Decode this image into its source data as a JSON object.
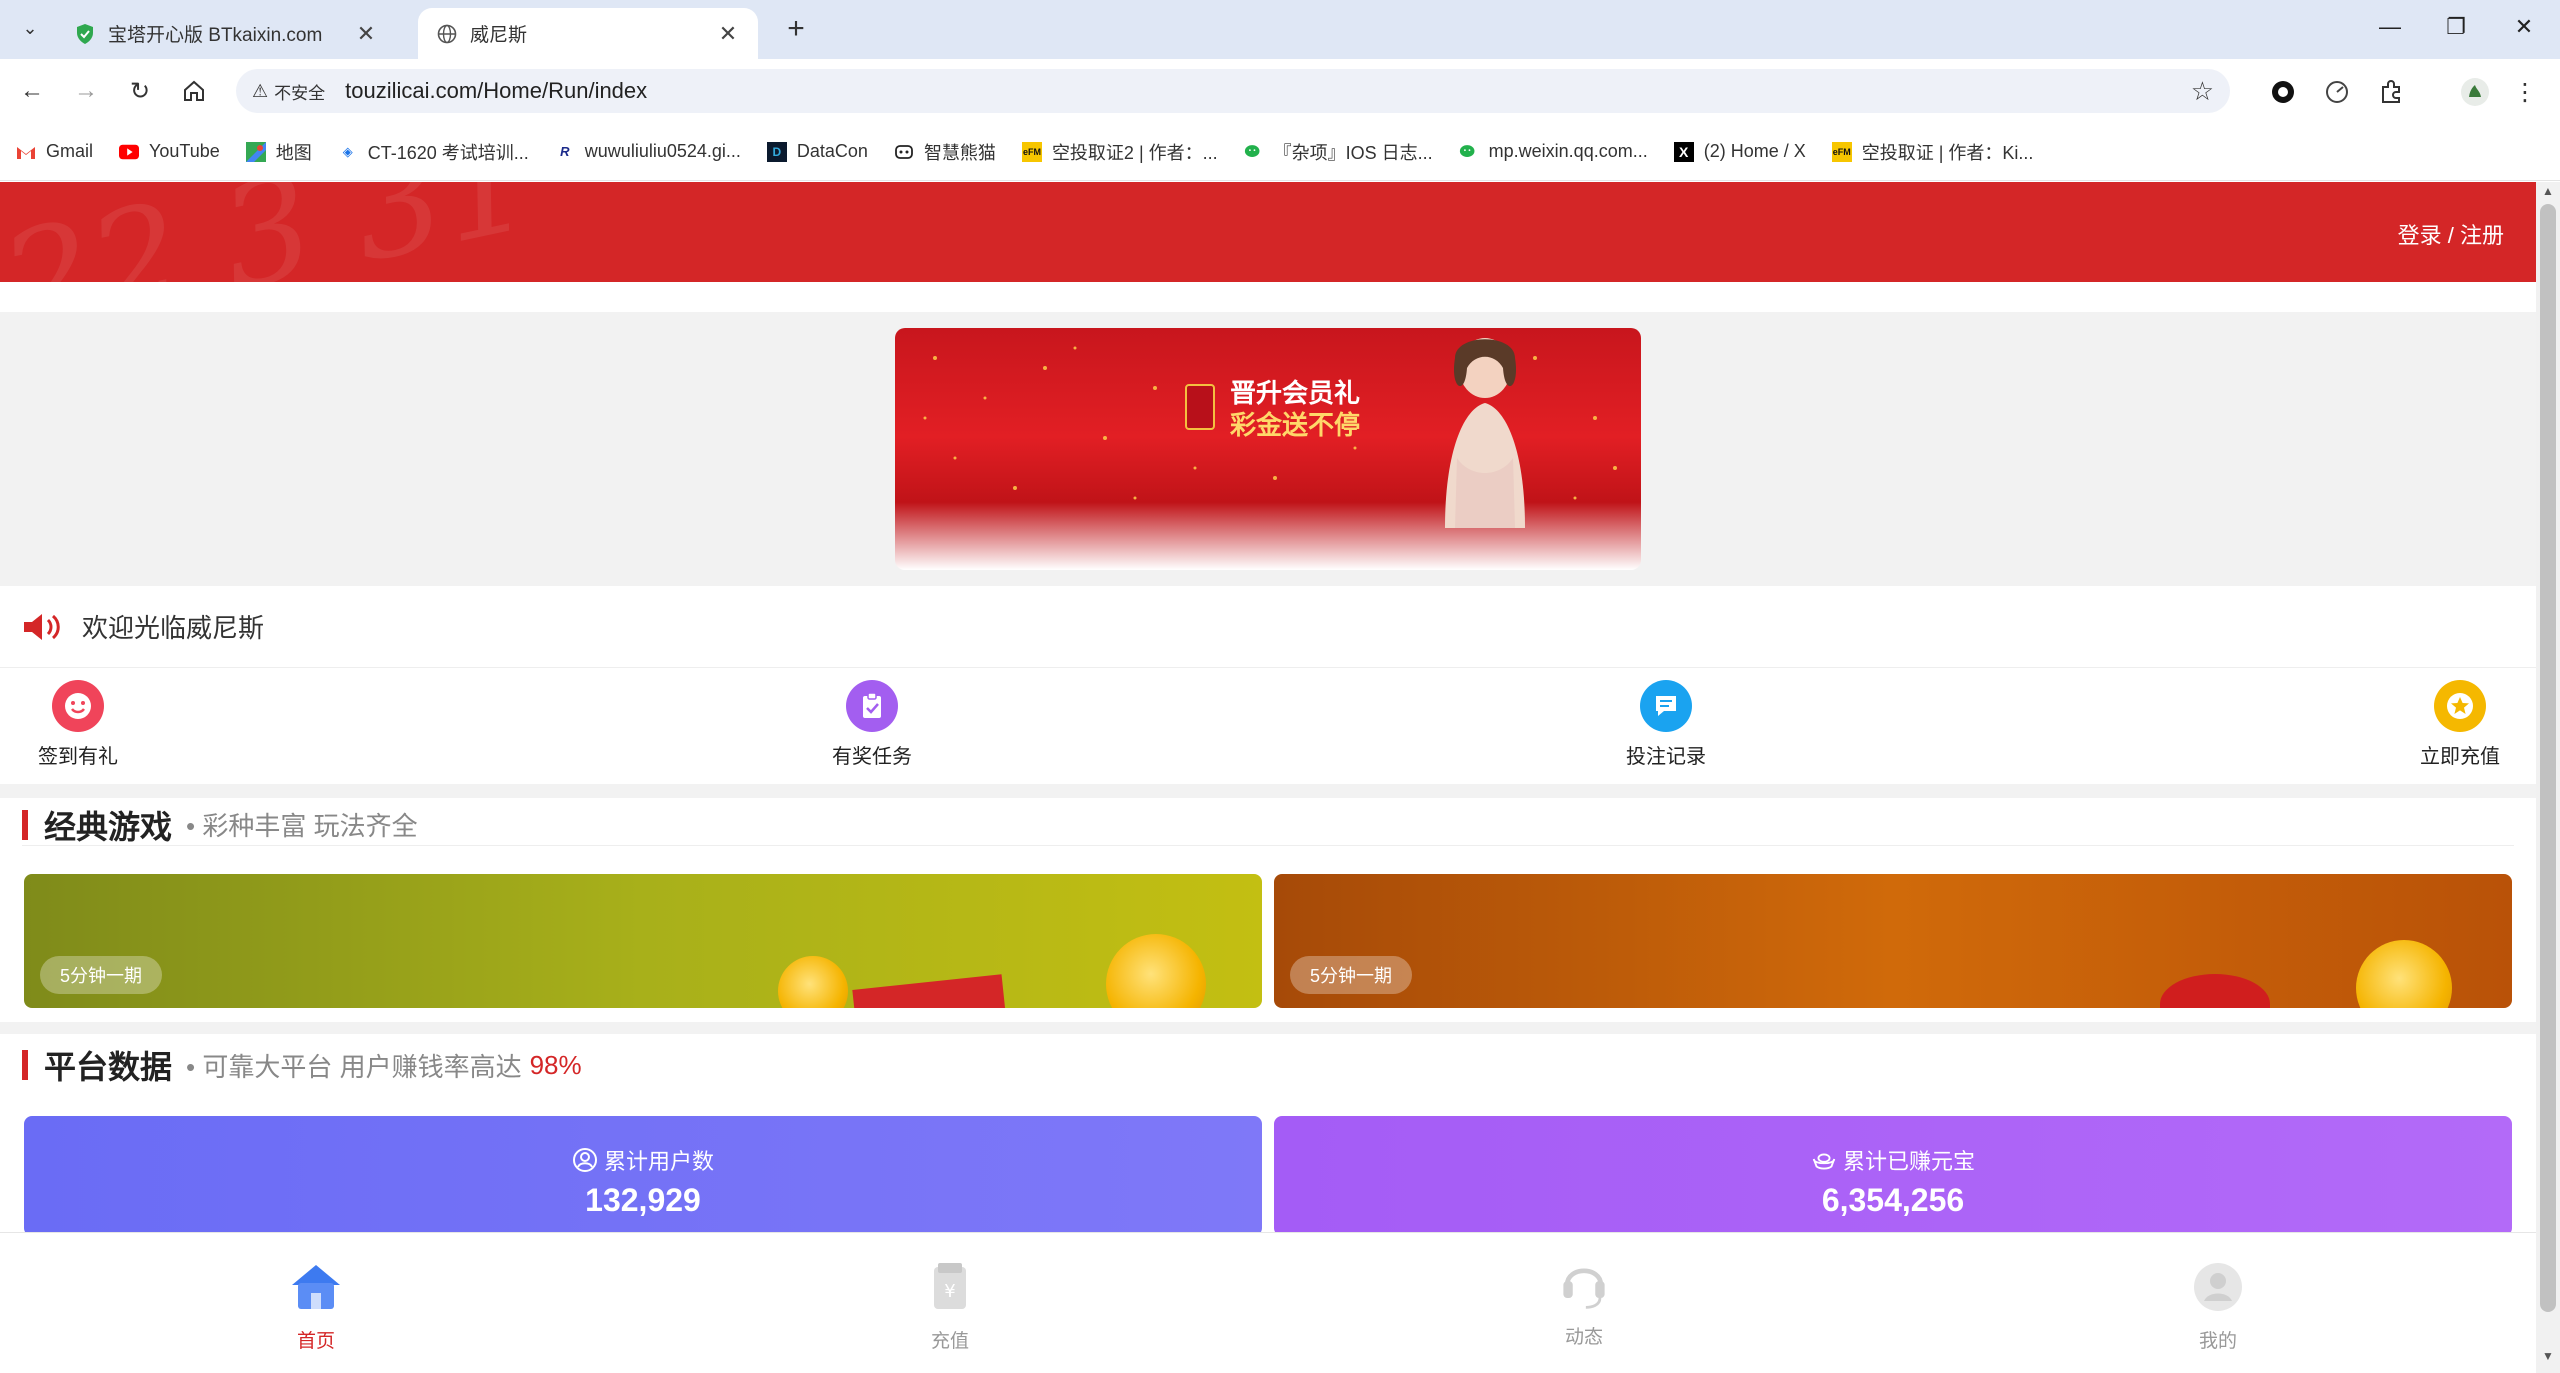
{
  "browser": {
    "tabs": [
      {
        "title": "宝塔开心版 BTkaixin.com",
        "active": false
      },
      {
        "title": "威尼斯",
        "active": true
      }
    ],
    "security_label": "不安全",
    "url": "touzilicai.com/Home/Run/index",
    "bookmarks": [
      {
        "label": "Gmail",
        "icon": "gmail-icon"
      },
      {
        "label": "YouTube",
        "icon": "youtube-icon"
      },
      {
        "label": "地图",
        "icon": "maps-icon"
      },
      {
        "label": "CT-1620 考试培训...",
        "icon": "diamond-icon"
      },
      {
        "label": "wuwuliuliu0524.gi...",
        "icon": "r-icon"
      },
      {
        "label": "DataCon",
        "icon": "datacon-icon"
      },
      {
        "label": "智慧熊猫",
        "icon": "panda-icon"
      },
      {
        "label": "空投取证2 | 作者：...",
        "icon": "efm-icon"
      },
      {
        "label": "『杂项』IOS 日志...",
        "icon": "wechat-icon"
      },
      {
        "label": "mp.weixin.qq.com...",
        "icon": "wechat-icon"
      },
      {
        "label": "(2) Home / X",
        "icon": "x-icon"
      },
      {
        "label": "空投取证 | 作者：Ki...",
        "icon": "efm-icon"
      }
    ]
  },
  "header": {
    "login_label": "登录 / 注册"
  },
  "banner": {
    "line1": "晋升会员礼",
    "line2": "彩金送不停"
  },
  "welcome": {
    "message": "欢迎光临威尼斯"
  },
  "quick_actions": [
    {
      "label": "签到有礼",
      "icon": "smile-icon",
      "color": "#f0445a"
    },
    {
      "label": "有奖任务",
      "icon": "clipboard-check-icon",
      "color": "#a35ef0"
    },
    {
      "label": "投注记录",
      "icon": "document-icon",
      "color": "#1aa3f0"
    },
    {
      "label": "立即充值",
      "icon": "star-coin-icon",
      "color": "#f5b800"
    }
  ],
  "classic_games": {
    "title": "经典游戏",
    "subtitle": "• 彩种丰富 玩法齐全",
    "cards": [
      {
        "tag": "5分钟一期"
      },
      {
        "tag": "5分钟一期"
      }
    ]
  },
  "platform_data": {
    "title": "平台数据",
    "subtitle": "• 可靠大平台 用户赚钱率高达",
    "highlight": "98%",
    "stats": [
      {
        "label": "累计用户数",
        "value": "132,929",
        "icon": "user-circle-icon"
      },
      {
        "label": "累计已赚元宝",
        "value": "6,354,256",
        "icon": "ingot-icon"
      }
    ]
  },
  "bottom_nav": [
    {
      "label": "首页",
      "icon": "home-icon",
      "active": true
    },
    {
      "label": "充值",
      "icon": "wallet-icon",
      "active": false
    },
    {
      "label": "动态",
      "icon": "headset-icon",
      "active": false
    },
    {
      "label": "我的",
      "icon": "user-icon",
      "active": false
    }
  ],
  "colors": {
    "brand_red": "#d42627",
    "stat_blue": "#6a6cf5",
    "stat_purple": "#a45cf6"
  }
}
